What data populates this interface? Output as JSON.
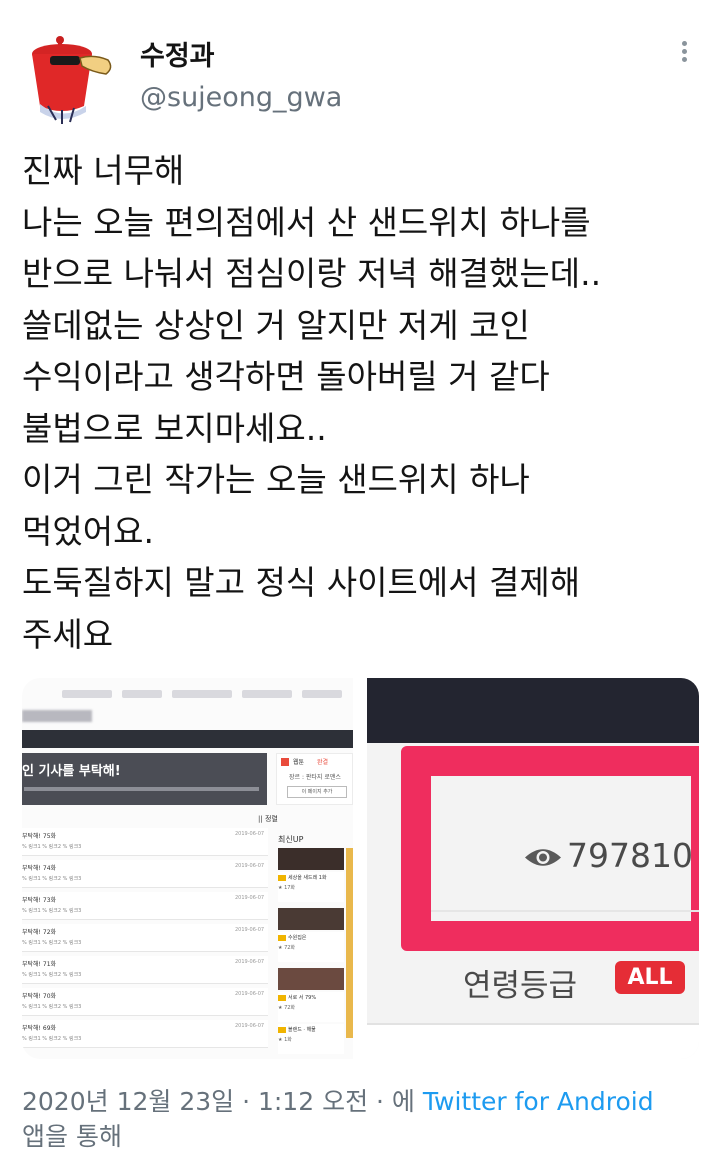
{
  "user": {
    "display_name": "수정과",
    "handle": "@sujeong_gwa",
    "avatar_icon": "red-mailbox-avatar-icon"
  },
  "more_icon": "more-vertical-icon",
  "tweet": {
    "lines": [
      "진짜 너무해",
      "나는 오늘 편의점에서 산 샌드위치 하나를",
      "반으로 나눠서 점심이랑 저녁 해결했는데..",
      "쓸데없는 상상인 거 알지만 저게 코인",
      "수익이라고 생각하면 돌아버릴 거 같다",
      "불법으로 보지마세요..",
      "이거 그린 작가는 오늘 샌드위치 하나",
      "먹었어요.",
      "도둑질하지 말고 정식 사이트에서 결제해",
      "주세요"
    ]
  },
  "media": {
    "left": {
      "banner_title": "인 기사를 부탁해!",
      "side_label": "웹툰",
      "side_status": "완결",
      "side_meta": "장르 : 판타지  로맨스",
      "side_button": "이 페이지 추가",
      "list_head": "|| 정렬",
      "recent_label": "최신UP",
      "rows": [
        {
          "title": "부탁해! 75화",
          "date": "2019-06-07",
          "links": "% 링크1  % 링크2  % 링크3"
        },
        {
          "title": "부탁해! 74화",
          "date": "2019-06-07",
          "links": "% 링크1  % 링크2  % 링크3"
        },
        {
          "title": "부탁해! 73화",
          "date": "2019-06-07",
          "links": "% 링크1  % 링크2  % 링크3"
        },
        {
          "title": "부탁해! 72화",
          "date": "2019-06-07",
          "links": "% 링크1  % 링크2  % 링크3"
        },
        {
          "title": "부탁해! 71화",
          "date": "2019-06-07",
          "links": "% 링크1  % 링크2  % 링크3"
        },
        {
          "title": "부탁해! 70화",
          "date": "2019-06-07",
          "links": "% 링크1  % 링크2  % 링크3"
        },
        {
          "title": "부탁해! 69화",
          "date": "2019-06-07",
          "links": "% 링크1  % 링크2  % 링크3"
        }
      ],
      "cards": [
        {
          "title": "세상을 새드레 1화",
          "sub": "★ 17화"
        },
        {
          "title": "수원집은",
          "sub": "★ 72화"
        },
        {
          "title": "서로 서 79%",
          "sub": "★ 72화"
        },
        {
          "title": "블랜드 · 해물",
          "sub": "★ 1화"
        }
      ]
    },
    "right": {
      "views": "797810",
      "eye_icon": "eye-icon",
      "rating_label": "연령등급",
      "rating_badge": "ALL"
    }
  },
  "footer": {
    "timestamp": "2020년 12월 23일 · 1:12 오전 · 에",
    "source": "Twitter for Android",
    "tail": "앱을 통해"
  }
}
